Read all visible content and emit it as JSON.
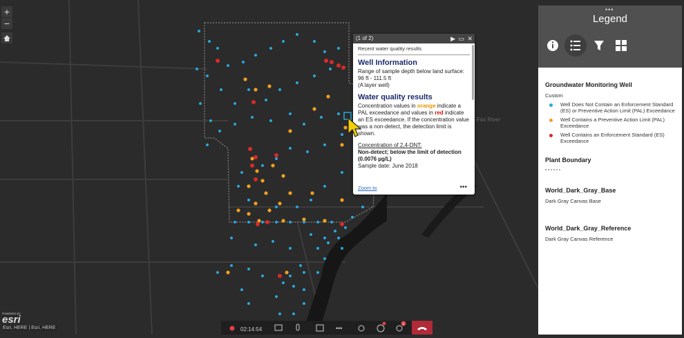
{
  "map": {
    "zoom_in": "+",
    "zoom_out": "−",
    "river_label": "Fox River",
    "attribution": "Esri, HERE | Esri, HERE",
    "powered_by": "POWERED BY",
    "logo": "esri",
    "colors": {
      "blue": "#29a8e0",
      "orange": "#f0a020",
      "red": "#d82a2a"
    }
  },
  "popup": {
    "counter": "(1 of 2)",
    "subtitle": "Recent water quality results",
    "well_title": "Well Information",
    "well_l1": "Range of sample depth below land surface:",
    "well_l2": "96 ft - 111.5 ft",
    "well_l3": "(A layer well)",
    "wq_title": "Water quality results",
    "wq_t1": "Concentration values in",
    "wq_orange": "orange",
    "wq_t2": "indicate a PAL exceedance and values in",
    "wq_red": "red",
    "wq_t3": "indicate an ES exceedance. If the concentration value was a non-detect, the detection limit is shown.",
    "conc_label": "Concentration of 2,4-DNT:",
    "conc_value": "Non-detect; below the limit of detection (0.0076 µg/L)",
    "sample_date": "Sample date: June 2018",
    "zoom_to": "Zoom to",
    "more": "•••"
  },
  "legend": {
    "title": "Legend",
    "dots": "•••",
    "layer1": "Groundwater Monitoring Well",
    "custom": "Custom",
    "items": [
      "Well Does Not Contain an Enforcement Standard (ES) or Preventive Action Limit (PAL) Exceedance",
      "Well Contains a Preventive Action Limit (PAL) Exceedance",
      "Well Contains an Enforcement Standard (ES) Exceedance"
    ],
    "layer2": "Plant Boundary",
    "layer3": "World_Dark_Gray_Base",
    "layer3_sub": "Dark Gray Canvas Base",
    "layer4": "World_Dark_Gray_Reference",
    "layer4_sub": "Dark Gray Canvas Reference"
  },
  "taskbar": {
    "time": "02:14:54",
    "badge": "3"
  }
}
